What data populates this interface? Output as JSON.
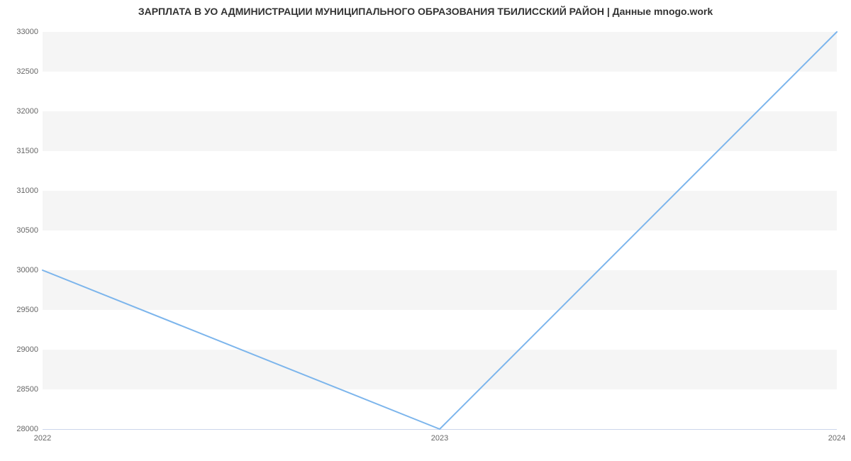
{
  "chart_data": {
    "type": "line",
    "title": "ЗАРПЛАТА В УО АДМИНИСТРАЦИИ МУНИЦИПАЛЬНОГО ОБРАЗОВАНИЯ ТБИЛИССКИЙ РАЙОН | Данные mnogo.work",
    "categories": [
      "2022",
      "2023",
      "2024"
    ],
    "values": [
      30000,
      28000,
      33000
    ],
    "xlabel": "",
    "ylabel": "",
    "ylim": [
      28000,
      33000
    ],
    "y_ticks": [
      28000,
      28500,
      29000,
      29500,
      30000,
      30500,
      31000,
      31500,
      32000,
      32500,
      33000
    ],
    "line_color": "#7cb5ec"
  },
  "y_tick_labels": {
    "t0": "28000",
    "t1": "28500",
    "t2": "29000",
    "t3": "29500",
    "t4": "30000",
    "t5": "30500",
    "t6": "31000",
    "t7": "31500",
    "t8": "32000",
    "t9": "32500",
    "t10": "33000"
  },
  "x_tick_labels": {
    "c0": "2022",
    "c1": "2023",
    "c2": "2024"
  }
}
